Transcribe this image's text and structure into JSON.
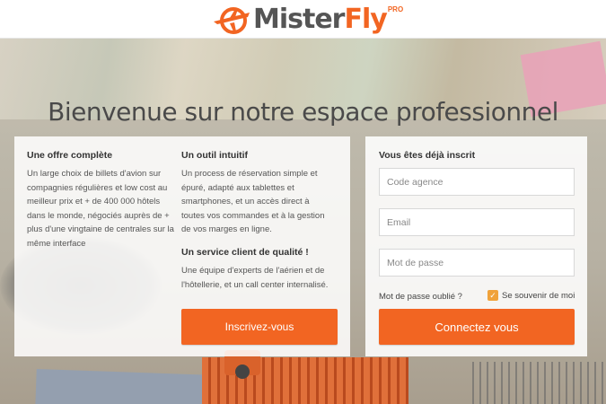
{
  "header": {
    "logo_text_1": "Mister",
    "logo_text_2": "Fly",
    "logo_badge": "PRO"
  },
  "page_title": "Bienvenue sur notre espace professionnel",
  "left_panel": {
    "col1": {
      "heading": "Une offre complète",
      "text": "Un large choix de billets d'avion sur compagnies régulières et low cost au meilleur prix et + de 400 000 hôtels dans le monde, négociés auprès de + plus d'une vingtaine de centrales sur la même interface"
    },
    "col2": {
      "heading": "Un outil intuitif",
      "text": "Un process de réservation simple et épuré, adapté aux tablettes et smartphones, et un accès direct à toutes vos commandes et à la gestion de vos marges en ligne."
    },
    "col3": {
      "heading": "Un service client de qualité !",
      "text": "Une équipe d'experts de l'aérien et de l'hôtellerie, et un call center internalisé."
    },
    "register_button": "Inscrivez-vous"
  },
  "login": {
    "heading": "Vous êtes déjà inscrit",
    "agency_placeholder": "Code agence",
    "email_placeholder": "Email",
    "password_placeholder": "Mot de passe",
    "forgot_password": "Mot de passe oublié ?",
    "remember_me": "Se souvenir de moi",
    "remember_checked": true,
    "submit_button": "Connectez vous"
  },
  "colors": {
    "accent": "#f26522",
    "checkbox": "#f0a23a",
    "text": "#333333"
  }
}
